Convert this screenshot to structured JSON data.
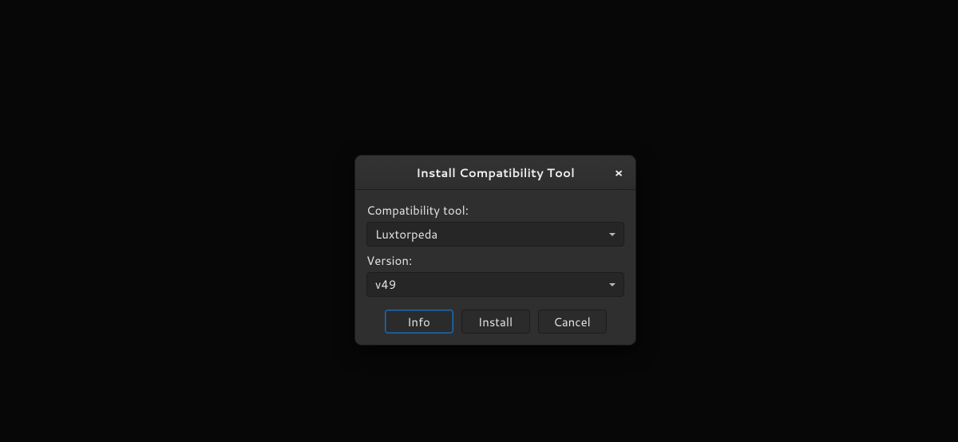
{
  "dialog": {
    "title": "Install Compatibility Tool",
    "fields": {
      "tool_label": "Compatibility tool:",
      "tool_value": "Luxtorpeda",
      "version_label": "Version:",
      "version_value": "v49"
    },
    "buttons": {
      "info": "Info",
      "install": "Install",
      "cancel": "Cancel"
    }
  }
}
